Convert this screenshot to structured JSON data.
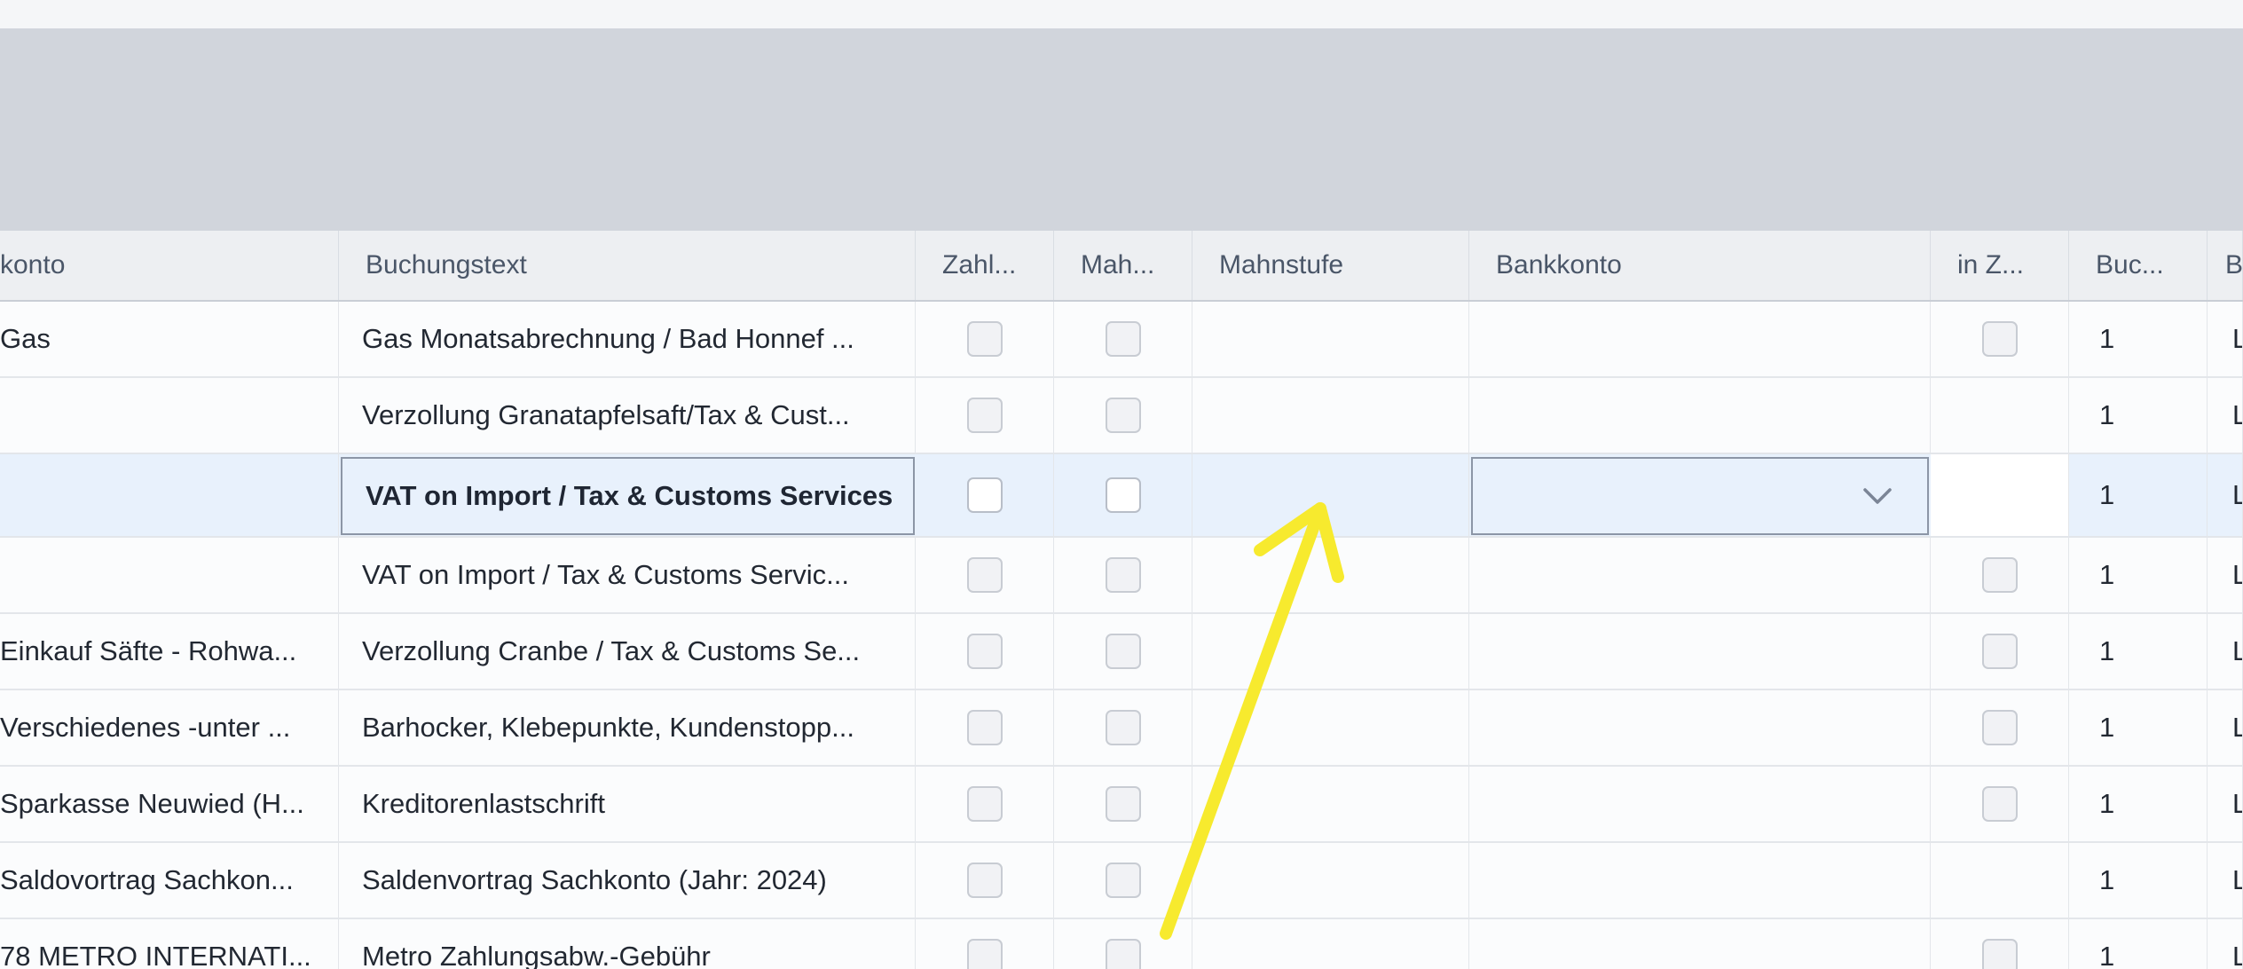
{
  "headers": {
    "konto": "konto",
    "buchungstext": "Buchungstext",
    "zahl": "Zahl...",
    "mah": "Mah...",
    "mahnstufe": "Mahnstufe",
    "bankkonto": "Bankkonto",
    "inz": "in Z...",
    "buc": "Buc...",
    "last": "B"
  },
  "rows": [
    {
      "konto": "Gas",
      "text": "Gas Monatsabrechnung / Bad Honnef ...",
      "inz_checkbox": true,
      "buc": "1",
      "last": "L"
    },
    {
      "konto": "",
      "text": "Verzollung Granatapfelsaft/Tax & Cust...",
      "inz_checkbox": false,
      "buc": "1",
      "last": "L"
    },
    {
      "konto": "",
      "text": "VAT on Import / Tax & Customs Services",
      "inz_checkbox": false,
      "buc": "1",
      "last": "L",
      "selected": true
    },
    {
      "konto": "",
      "text": "VAT on Import / Tax & Customs Servic...",
      "inz_checkbox": true,
      "buc": "1",
      "last": "L"
    },
    {
      "konto": "Einkauf Säfte - Rohwa...",
      "text": "Verzollung Cranbe / Tax & Customs Se...",
      "inz_checkbox": true,
      "buc": "1",
      "last": "L"
    },
    {
      "konto": "Verschiedenes -unter ...",
      "text": "Barhocker, Klebepunkte, Kundenstopp...",
      "inz_checkbox": true,
      "buc": "1",
      "last": "L"
    },
    {
      "konto": "Sparkasse Neuwied (H...",
      "text": "Kreditorenlastschrift",
      "inz_checkbox": true,
      "buc": "1",
      "last": "L"
    },
    {
      "konto": "Saldovortrag Sachkon...",
      "text": "Saldenvortrag Sachkonto (Jahr: 2024)",
      "inz_checkbox": false,
      "buc": "1",
      "last": "L"
    },
    {
      "konto": "78 METRO INTERNATI...",
      "text": "Metro Zahlungsabw.-Gebühr",
      "inz_checkbox": true,
      "buc": "1",
      "last": "L"
    }
  ],
  "colors": {
    "arrow": "#f7ea2e",
    "selected_row": "#e8f1fc",
    "header_bg": "#edeff2",
    "band": "#d1d5dc"
  },
  "icons": {
    "dropdown": "chevron-down-icon",
    "annotation": "arrow-annotation"
  }
}
